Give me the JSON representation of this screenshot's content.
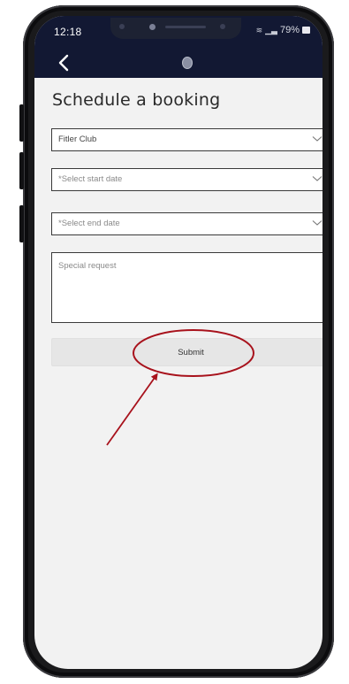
{
  "status_bar": {
    "time": "12:18",
    "battery": "79%",
    "icons": [
      "wifi-icon",
      "signal-icon",
      "battery-icon"
    ]
  },
  "nav": {
    "back_icon": "chevron-left-icon",
    "logo_icon": "app-logo-icon"
  },
  "page": {
    "title": "Schedule a booking"
  },
  "form": {
    "club_select": {
      "value": "Fitler Club"
    },
    "start_date_select": {
      "placeholder": "*Select start date"
    },
    "end_date_select": {
      "placeholder": "*Select end date"
    },
    "special_request": {
      "placeholder": "Special request"
    },
    "submit_label": "Submit"
  },
  "annotation": {
    "highlight_color": "#a8121c"
  },
  "colors": {
    "nav_background": "#121833",
    "page_background": "#f2f2f2",
    "field_border": "#3a3a3a",
    "button_background": "#e6e6e6"
  }
}
